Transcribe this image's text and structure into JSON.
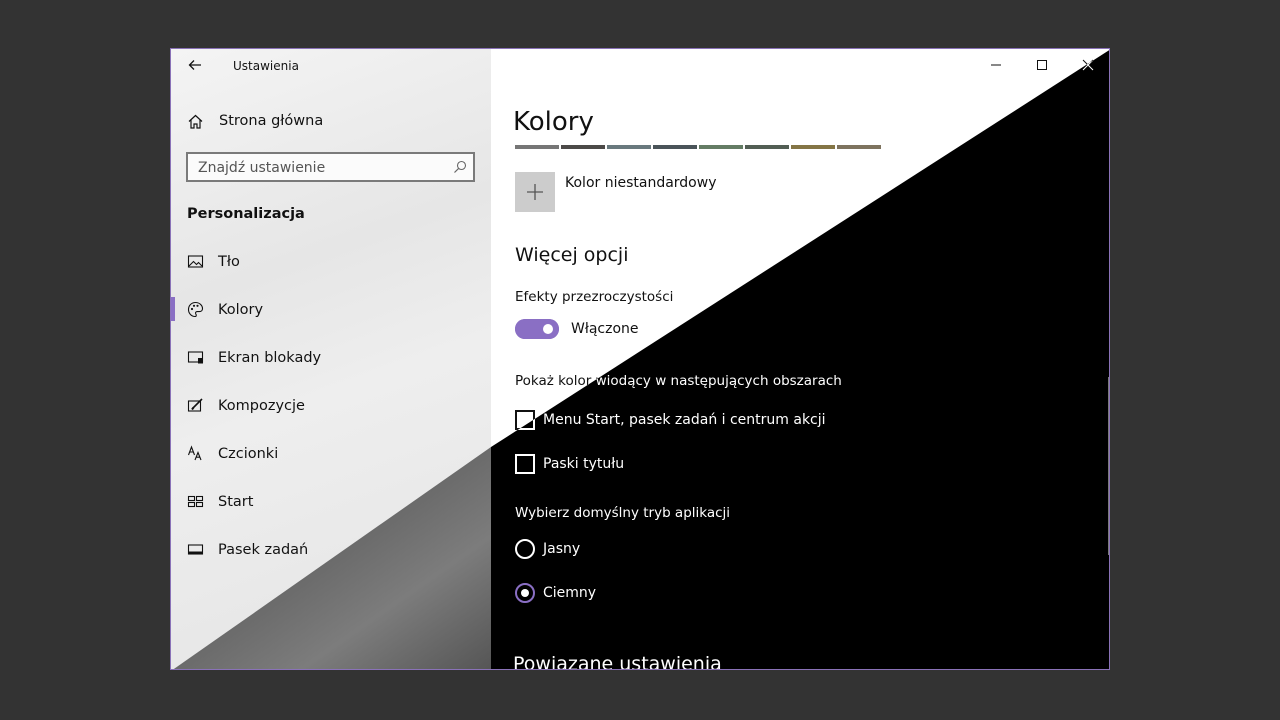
{
  "window": {
    "title": "Ustawienia",
    "accent_color": "#8a6fc4"
  },
  "titlebar": {
    "back_icon": "back-arrow-icon",
    "minimize_icon": "minimize-icon",
    "maximize_icon": "maximize-icon",
    "close_icon": "close-icon"
  },
  "sidebar": {
    "home_label": "Strona główna",
    "search_placeholder": "Znajdź ustawienie",
    "section_title": "Personalizacja",
    "items": [
      {
        "label": "Tło",
        "icon": "picture-icon",
        "selected": false
      },
      {
        "label": "Kolory",
        "icon": "palette-icon",
        "selected": true
      },
      {
        "label": "Ekran blokady",
        "icon": "lock-screen-icon",
        "selected": false
      },
      {
        "label": "Kompozycje",
        "icon": "themes-icon",
        "selected": false
      },
      {
        "label": "Czcionki",
        "icon": "fonts-icon",
        "selected": false
      },
      {
        "label": "Start",
        "icon": "start-icon",
        "selected": false
      },
      {
        "label": "Pasek zadań",
        "icon": "taskbar-icon",
        "selected": false
      }
    ]
  },
  "main": {
    "page_title": "Kolory",
    "swatch_colors": [
      "#767676",
      "#4c4a48",
      "#69797e",
      "#4a5459",
      "#647c64",
      "#525e54",
      "#847545",
      "#7e735f"
    ],
    "custom_color_label": "Kolor niestandardowy",
    "more_options_heading": "Więcej opcji",
    "transparency": {
      "label": "Efekty przezroczystości",
      "state_label": "Włączone",
      "on": true
    },
    "accent_surfaces": {
      "label": "Pokaż kolor wiodący w następujących obszarach",
      "options": [
        {
          "label": "Menu Start, pasek zadań i centrum akcji",
          "checked": false
        },
        {
          "label": "Paski tytułu",
          "checked": false
        }
      ]
    },
    "app_mode": {
      "label": "Wybierz domyślny tryb aplikacji",
      "options": [
        {
          "label": "Jasny",
          "selected": false
        },
        {
          "label": "Ciemny",
          "selected": true
        }
      ]
    },
    "related_heading": "Powiązane ustawienia"
  }
}
